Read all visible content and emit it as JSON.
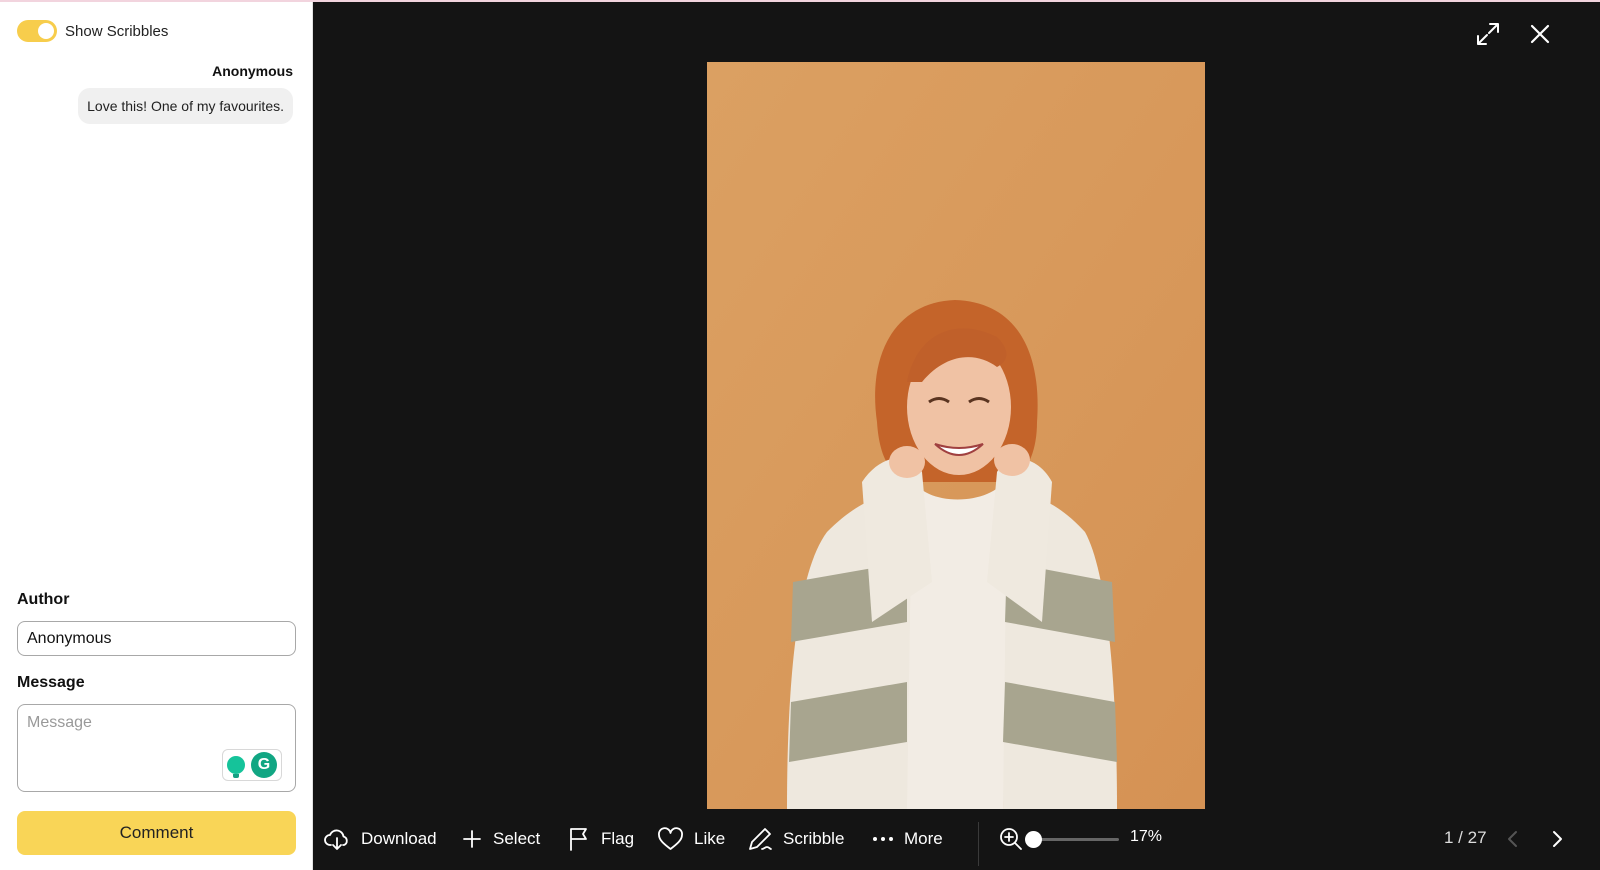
{
  "colors": {
    "accent_yellow": "#f9d557",
    "toggle_on": "#f7cd4c",
    "viewer_bg": "#141414",
    "photo_bg": "#d9995c"
  },
  "sidebar": {
    "scribbles_toggle": {
      "label": "Show Scribbles",
      "on": true
    },
    "comments": [
      {
        "author": "Anonymous",
        "message": "Love this! One of my favourites."
      }
    ],
    "form": {
      "author_label": "Author",
      "author_value": "Anonymous",
      "message_label": "Message",
      "message_placeholder": "Message",
      "message_value": "",
      "submit_label": "Comment"
    }
  },
  "viewer": {
    "photo_description_icon": "portrait-photo",
    "toolbar": {
      "download": "Download",
      "select": "Select",
      "flag": "Flag",
      "like": "Like",
      "scribble": "Scribble",
      "more": "More"
    },
    "zoom": {
      "percent": 17,
      "label": "17%"
    },
    "pagination": {
      "current": 1,
      "total": 27,
      "label": "1 / 27"
    }
  }
}
